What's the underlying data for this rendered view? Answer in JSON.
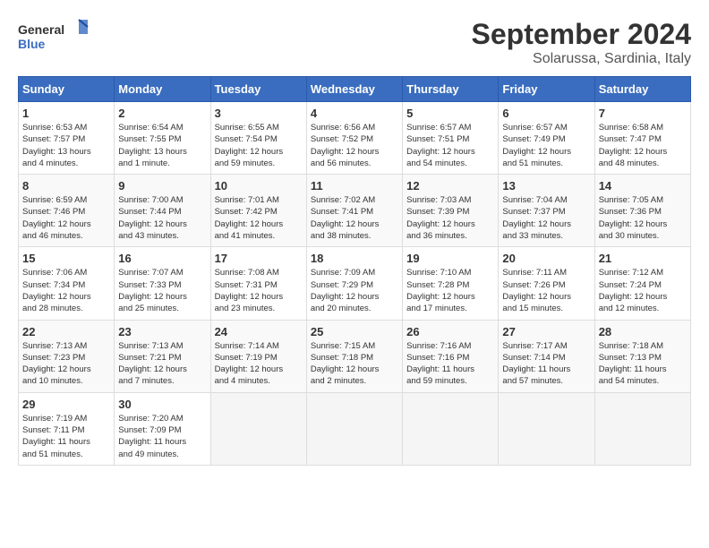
{
  "header": {
    "logo_line1": "General",
    "logo_line2": "Blue",
    "month": "September 2024",
    "location": "Solarussa, Sardinia, Italy"
  },
  "weekdays": [
    "Sunday",
    "Monday",
    "Tuesday",
    "Wednesday",
    "Thursday",
    "Friday",
    "Saturday"
  ],
  "weeks": [
    [
      {
        "day": "1",
        "info": "Sunrise: 6:53 AM\nSunset: 7:57 PM\nDaylight: 13 hours\nand 4 minutes."
      },
      {
        "day": "2",
        "info": "Sunrise: 6:54 AM\nSunset: 7:55 PM\nDaylight: 13 hours\nand 1 minute."
      },
      {
        "day": "3",
        "info": "Sunrise: 6:55 AM\nSunset: 7:54 PM\nDaylight: 12 hours\nand 59 minutes."
      },
      {
        "day": "4",
        "info": "Sunrise: 6:56 AM\nSunset: 7:52 PM\nDaylight: 12 hours\nand 56 minutes."
      },
      {
        "day": "5",
        "info": "Sunrise: 6:57 AM\nSunset: 7:51 PM\nDaylight: 12 hours\nand 54 minutes."
      },
      {
        "day": "6",
        "info": "Sunrise: 6:57 AM\nSunset: 7:49 PM\nDaylight: 12 hours\nand 51 minutes."
      },
      {
        "day": "7",
        "info": "Sunrise: 6:58 AM\nSunset: 7:47 PM\nDaylight: 12 hours\nand 48 minutes."
      }
    ],
    [
      {
        "day": "8",
        "info": "Sunrise: 6:59 AM\nSunset: 7:46 PM\nDaylight: 12 hours\nand 46 minutes."
      },
      {
        "day": "9",
        "info": "Sunrise: 7:00 AM\nSunset: 7:44 PM\nDaylight: 12 hours\nand 43 minutes."
      },
      {
        "day": "10",
        "info": "Sunrise: 7:01 AM\nSunset: 7:42 PM\nDaylight: 12 hours\nand 41 minutes."
      },
      {
        "day": "11",
        "info": "Sunrise: 7:02 AM\nSunset: 7:41 PM\nDaylight: 12 hours\nand 38 minutes."
      },
      {
        "day": "12",
        "info": "Sunrise: 7:03 AM\nSunset: 7:39 PM\nDaylight: 12 hours\nand 36 minutes."
      },
      {
        "day": "13",
        "info": "Sunrise: 7:04 AM\nSunset: 7:37 PM\nDaylight: 12 hours\nand 33 minutes."
      },
      {
        "day": "14",
        "info": "Sunrise: 7:05 AM\nSunset: 7:36 PM\nDaylight: 12 hours\nand 30 minutes."
      }
    ],
    [
      {
        "day": "15",
        "info": "Sunrise: 7:06 AM\nSunset: 7:34 PM\nDaylight: 12 hours\nand 28 minutes."
      },
      {
        "day": "16",
        "info": "Sunrise: 7:07 AM\nSunset: 7:33 PM\nDaylight: 12 hours\nand 25 minutes."
      },
      {
        "day": "17",
        "info": "Sunrise: 7:08 AM\nSunset: 7:31 PM\nDaylight: 12 hours\nand 23 minutes."
      },
      {
        "day": "18",
        "info": "Sunrise: 7:09 AM\nSunset: 7:29 PM\nDaylight: 12 hours\nand 20 minutes."
      },
      {
        "day": "19",
        "info": "Sunrise: 7:10 AM\nSunset: 7:28 PM\nDaylight: 12 hours\nand 17 minutes."
      },
      {
        "day": "20",
        "info": "Sunrise: 7:11 AM\nSunset: 7:26 PM\nDaylight: 12 hours\nand 15 minutes."
      },
      {
        "day": "21",
        "info": "Sunrise: 7:12 AM\nSunset: 7:24 PM\nDaylight: 12 hours\nand 12 minutes."
      }
    ],
    [
      {
        "day": "22",
        "info": "Sunrise: 7:13 AM\nSunset: 7:23 PM\nDaylight: 12 hours\nand 10 minutes."
      },
      {
        "day": "23",
        "info": "Sunrise: 7:13 AM\nSunset: 7:21 PM\nDaylight: 12 hours\nand 7 minutes."
      },
      {
        "day": "24",
        "info": "Sunrise: 7:14 AM\nSunset: 7:19 PM\nDaylight: 12 hours\nand 4 minutes."
      },
      {
        "day": "25",
        "info": "Sunrise: 7:15 AM\nSunset: 7:18 PM\nDaylight: 12 hours\nand 2 minutes."
      },
      {
        "day": "26",
        "info": "Sunrise: 7:16 AM\nSunset: 7:16 PM\nDaylight: 11 hours\nand 59 minutes."
      },
      {
        "day": "27",
        "info": "Sunrise: 7:17 AM\nSunset: 7:14 PM\nDaylight: 11 hours\nand 57 minutes."
      },
      {
        "day": "28",
        "info": "Sunrise: 7:18 AM\nSunset: 7:13 PM\nDaylight: 11 hours\nand 54 minutes."
      }
    ],
    [
      {
        "day": "29",
        "info": "Sunrise: 7:19 AM\nSunset: 7:11 PM\nDaylight: 11 hours\nand 51 minutes."
      },
      {
        "day": "30",
        "info": "Sunrise: 7:20 AM\nSunset: 7:09 PM\nDaylight: 11 hours\nand 49 minutes."
      },
      {
        "day": "",
        "info": ""
      },
      {
        "day": "",
        "info": ""
      },
      {
        "day": "",
        "info": ""
      },
      {
        "day": "",
        "info": ""
      },
      {
        "day": "",
        "info": ""
      }
    ]
  ]
}
